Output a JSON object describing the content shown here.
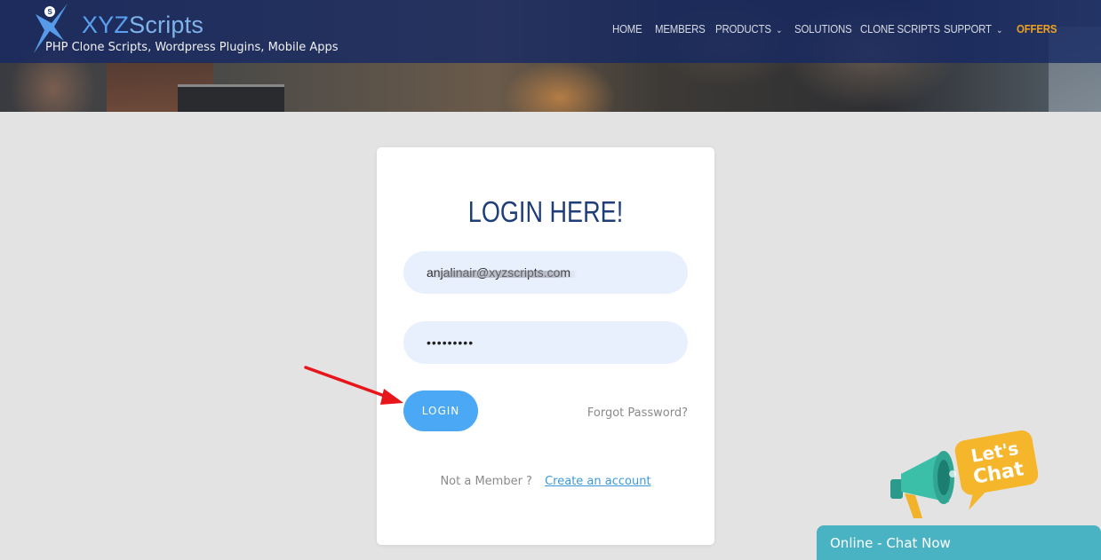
{
  "header": {
    "logo": {
      "part1": "XYZ",
      "part2": "Scripts"
    },
    "tagline": "PHP Clone Scripts, Wordpress Plugins, Mobile Apps",
    "nav": [
      {
        "label": "HOME"
      },
      {
        "label": "MEMBERS"
      },
      {
        "label": "PRODUCTS",
        "has_dropdown": true
      },
      {
        "label": "SOLUTIONS"
      },
      {
        "label": "CLONE SCRIPTS"
      },
      {
        "label": "SUPPORT",
        "has_dropdown": true
      },
      {
        "label": "OFFERS"
      }
    ]
  },
  "login": {
    "title": "LOGIN HERE!",
    "email_value": "anjalinair@xyzscripts.com",
    "password_value": "•••••••••",
    "login_button": "LOGIN",
    "forgot_link": "Forgot Password?",
    "not_member_text": "Not a Member ?",
    "create_account_link": "Create an account"
  },
  "chat": {
    "badge_line1": "Let's",
    "badge_line2": "Chat",
    "bar_label": "Online - Chat Now"
  },
  "colors": {
    "header_overlay": "#142864",
    "offers": "#f0a020",
    "title": "#1f3e78",
    "input_bg": "#e8f0fe",
    "login_button": "#4aa8f5",
    "link": "#3a9ad9",
    "chat_bar": "#4ab3c3",
    "arrow": "#e8151b"
  },
  "icons": [
    "logo-figure-icon",
    "chevron-down-icon",
    "red-arrow-icon",
    "megaphone-icon"
  ]
}
